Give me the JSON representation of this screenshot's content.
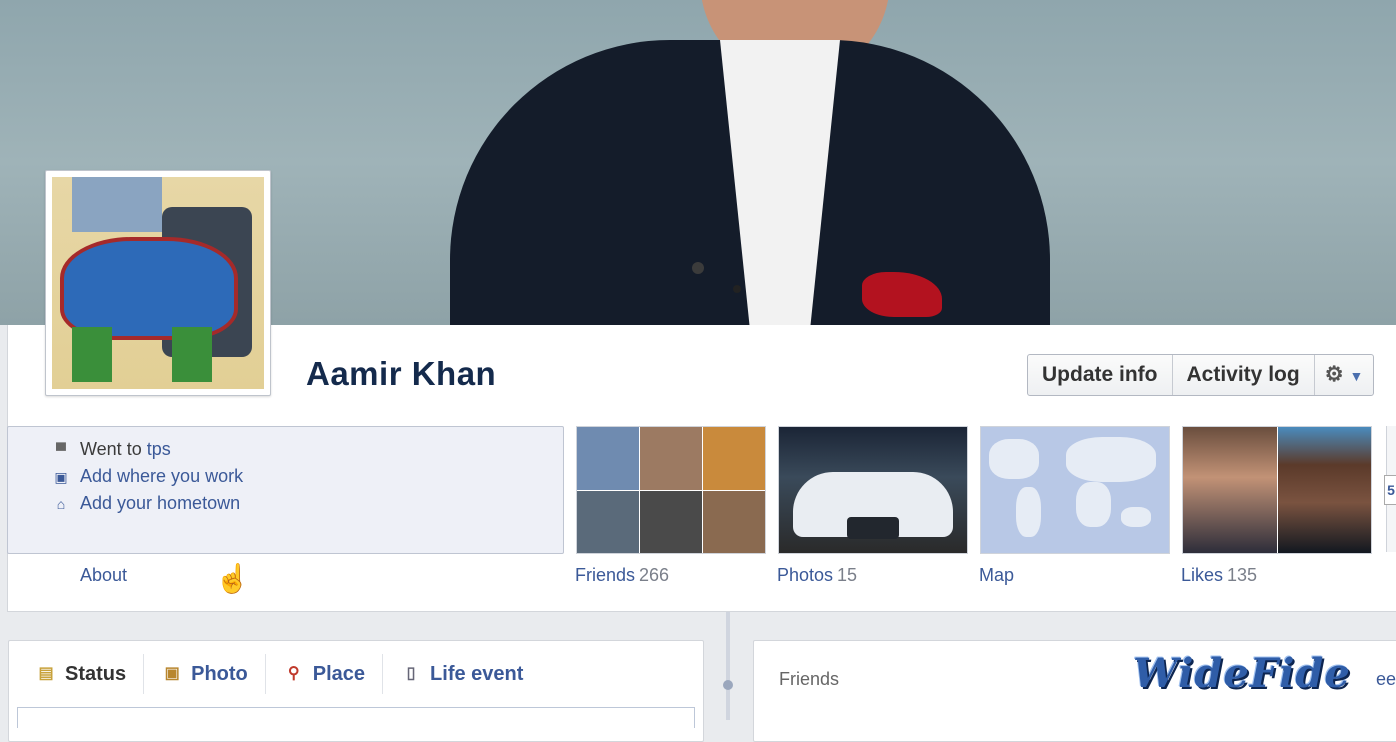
{
  "profile": {
    "name": "Aamir Khan"
  },
  "actions": {
    "update_info": "Update info",
    "activity_log": "Activity log",
    "settings_icon": "gear-icon"
  },
  "info": {
    "went_to_prefix": "Went to ",
    "went_to_link": "tps",
    "add_work": "Add where you work",
    "add_hometown": "Add your hometown",
    "about": "About"
  },
  "tiles": {
    "friends": {
      "label": "Friends",
      "count": "266"
    },
    "photos": {
      "label": "Photos",
      "count": "15"
    },
    "map": {
      "label": "Map"
    },
    "likes": {
      "label": "Likes",
      "count": "135"
    }
  },
  "composer": {
    "tabs": [
      {
        "label": "Status",
        "icon": "status-icon"
      },
      {
        "label": "Photo",
        "icon": "photo-icon"
      },
      {
        "label": "Place",
        "icon": "place-icon"
      },
      {
        "label": "Life event",
        "icon": "life-event-icon"
      }
    ]
  },
  "friends_box": {
    "title": "Friends",
    "see_all_fragment": "ee"
  },
  "edge_tab": "5",
  "watermark": "WideFide",
  "colors": {
    "link": "#3b5998",
    "name": "#142a4c",
    "background": "#e9ebee"
  }
}
